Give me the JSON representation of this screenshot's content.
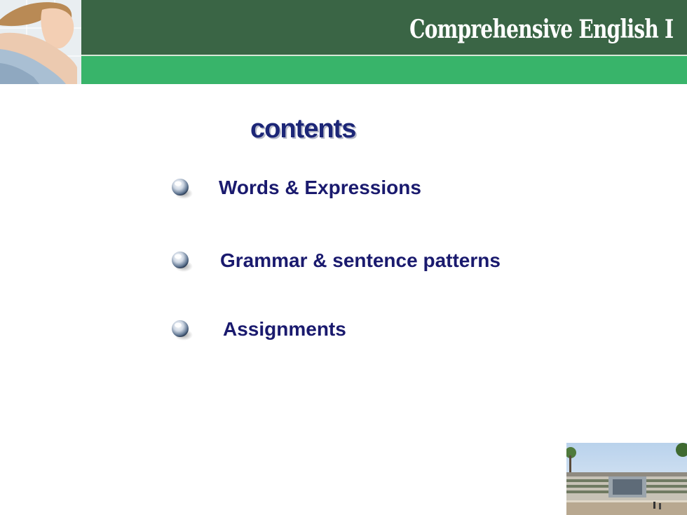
{
  "header": {
    "title": "Comprehensive English I",
    "colors": {
      "dark_band": "#3a6545",
      "light_band": "#38b46a"
    }
  },
  "contents": {
    "title": "contents",
    "title_color": "#1c2677",
    "items": [
      {
        "label": "Words & Expressions",
        "icon": "glass-bullet-icon"
      },
      {
        "label": "Grammar & sentence patterns",
        "icon": "glass-bullet-icon"
      },
      {
        "label": "Assignments",
        "icon": "glass-bullet-icon"
      }
    ]
  },
  "images": {
    "header_photo": "woman-photo",
    "corner_photo": "campus-building-photo"
  }
}
